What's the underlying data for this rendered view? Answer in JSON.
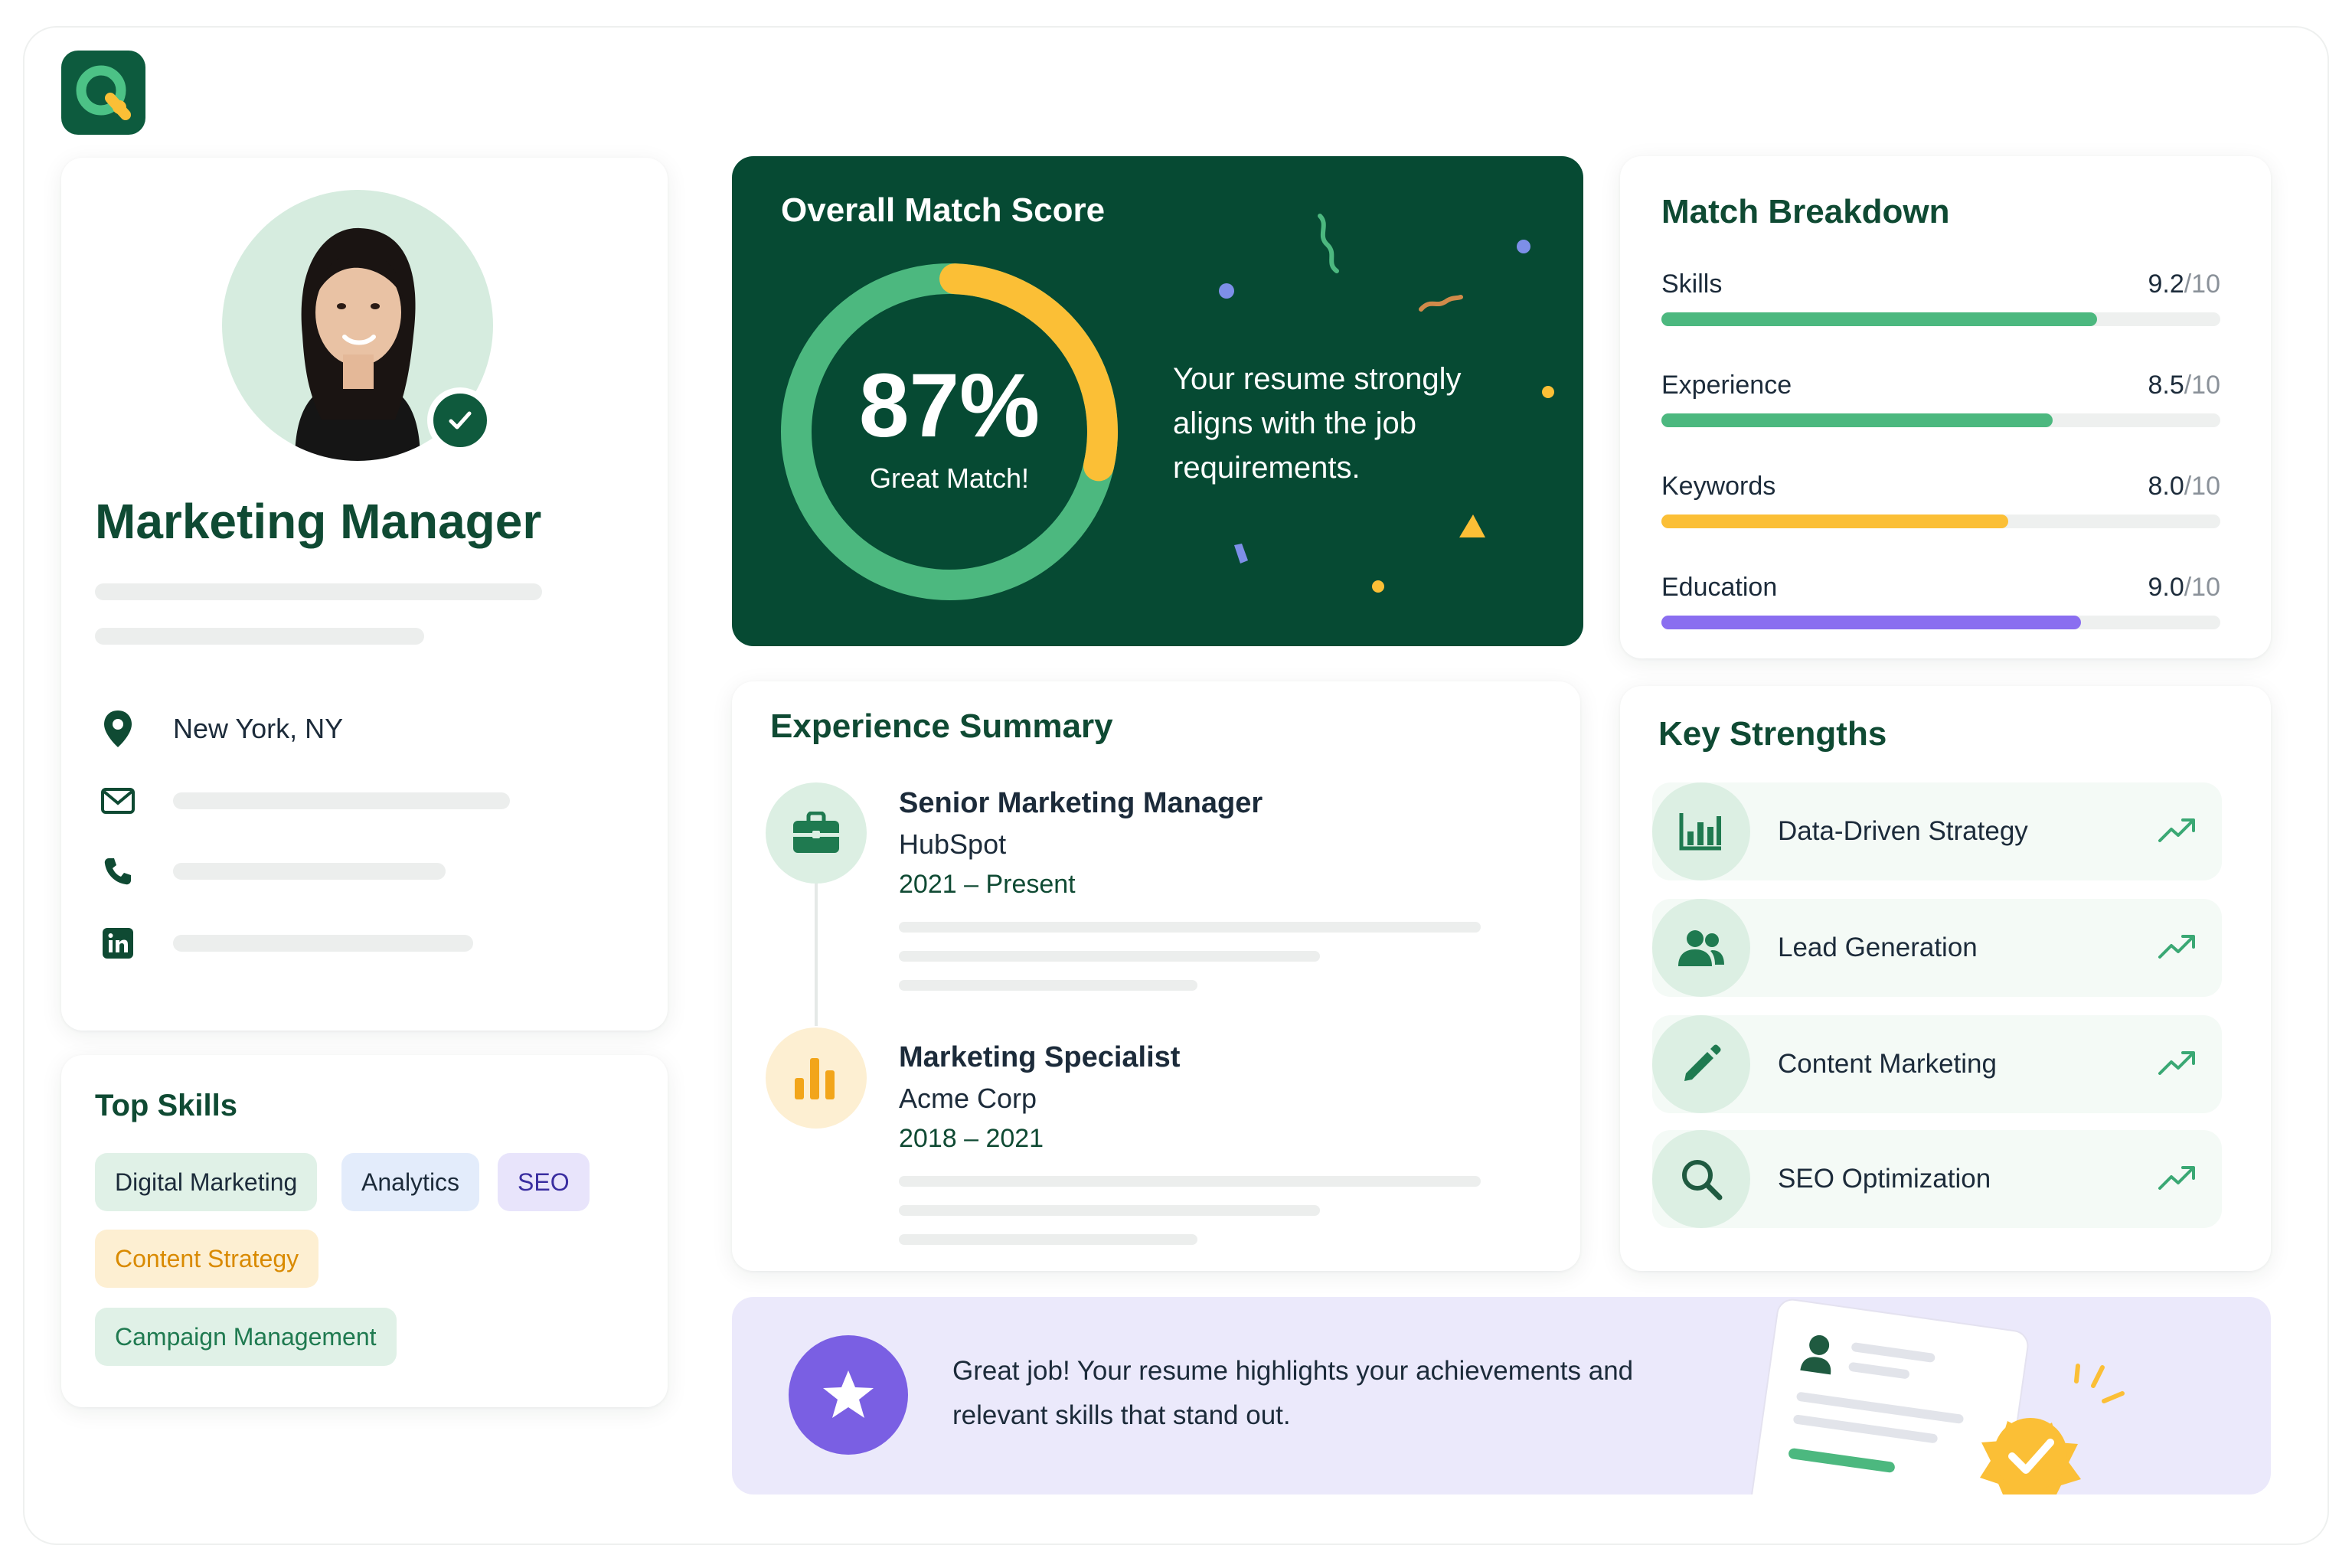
{
  "app": {
    "logo_letter": "Q"
  },
  "profile": {
    "title": "Marketing Manager",
    "location": "New York, NY"
  },
  "skills": {
    "heading": "Top Skills",
    "chips": [
      "Digital Marketing",
      "Analytics",
      "SEO",
      "Content Strategy",
      "Campaign Management"
    ]
  },
  "score": {
    "heading": "Overall Match Score",
    "percent_label": "87%",
    "percent": 0.87,
    "sub": "Great Match!",
    "message": "Your resume strongly aligns with the job requirements."
  },
  "breakdown": {
    "heading": "Match Breakdown",
    "denominator": "/10",
    "metrics": [
      {
        "label": "Skills",
        "value": "9.2",
        "fraction": 0.78,
        "color": "#4cb87f"
      },
      {
        "label": "Experience",
        "value": "8.5",
        "fraction": 0.7,
        "color": "#4cb87f"
      },
      {
        "label": "Keywords",
        "value": "8.0",
        "fraction": 0.62,
        "color": "#fbbf36"
      },
      {
        "label": "Education",
        "value": "9.0",
        "fraction": 0.75,
        "color": "#8a6ef0"
      }
    ]
  },
  "experience": {
    "heading": "Experience Summary",
    "jobs": [
      {
        "title": "Senior Marketing Manager",
        "company": "HubSpot",
        "dates": "2021 – Present"
      },
      {
        "title": "Marketing Specialist",
        "company": "Acme Corp",
        "dates": "2018 – 2021"
      }
    ]
  },
  "strengths": {
    "heading": "Key Strengths",
    "items": [
      {
        "label": "Data-Driven Strategy",
        "icon": "bar-chart-icon"
      },
      {
        "label": "Lead Generation",
        "icon": "users-icon"
      },
      {
        "label": "Content Marketing",
        "icon": "pencil-icon"
      },
      {
        "label": "SEO Optimization",
        "icon": "search-icon"
      }
    ]
  },
  "banner": {
    "message": "Great job! Your resume highlights your achievements and relevant skills that stand out."
  },
  "colors": {
    "brand_green": "#0f4a33",
    "score_bg": "#064a33",
    "accent_yellow": "#fbbf36",
    "accent_purple": "#7a5fe3"
  }
}
